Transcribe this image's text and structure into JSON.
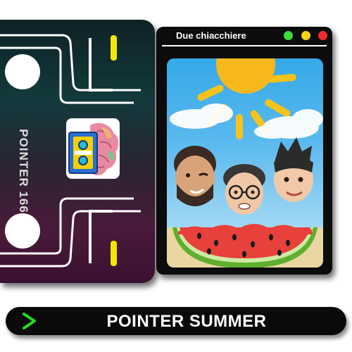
{
  "cassette": {
    "label": "POINTER 166",
    "icon": "brain-cassette-logo",
    "reel_indicator_color": "#f5e600"
  },
  "chat_window": {
    "title": "Due chiacchiere",
    "controls": [
      "green",
      "yellow",
      "red"
    ],
    "colors": {
      "green": "#3bdc3b",
      "yellow": "#f4d214",
      "red": "#ef2a2a"
    },
    "illustration": "three-memoji-faces-behind-watermelon-slice-under-sun"
  },
  "banner": {
    "title": "POINTER SUMMER",
    "icon": "chevron-right-icon",
    "accent": "#22e022"
  }
}
